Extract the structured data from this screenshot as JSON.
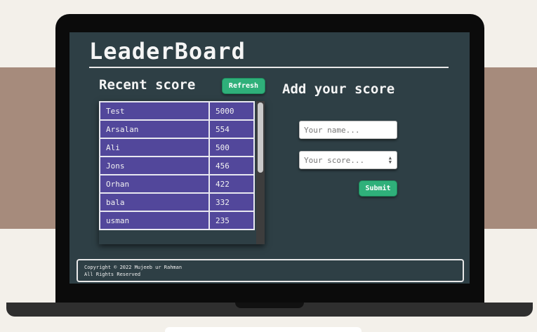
{
  "app": {
    "title": "LeaderBoard"
  },
  "recent": {
    "heading": "Recent score",
    "refresh_label": "Refresh"
  },
  "scores": [
    {
      "name": "Test",
      "score": "5000"
    },
    {
      "name": "Arsalan",
      "score": "554"
    },
    {
      "name": "Ali",
      "score": "500"
    },
    {
      "name": "Jons",
      "score": "456"
    },
    {
      "name": "Orhan",
      "score": "422"
    },
    {
      "name": "bala",
      "score": "332"
    },
    {
      "name": "usman",
      "score": "235"
    }
  ],
  "form": {
    "heading": "Add your score",
    "name_placeholder": "Your name...",
    "score_placeholder": "Your score...",
    "submit_label": "Submit"
  },
  "footer": {
    "copyright": "Copyright © 2022 Mujeeb ur Rahman",
    "rights": "All Rights Reserved"
  },
  "colors": {
    "screen_bg": "#2e3f45",
    "table_cell": "#52479b",
    "button": "#2fb07a"
  }
}
